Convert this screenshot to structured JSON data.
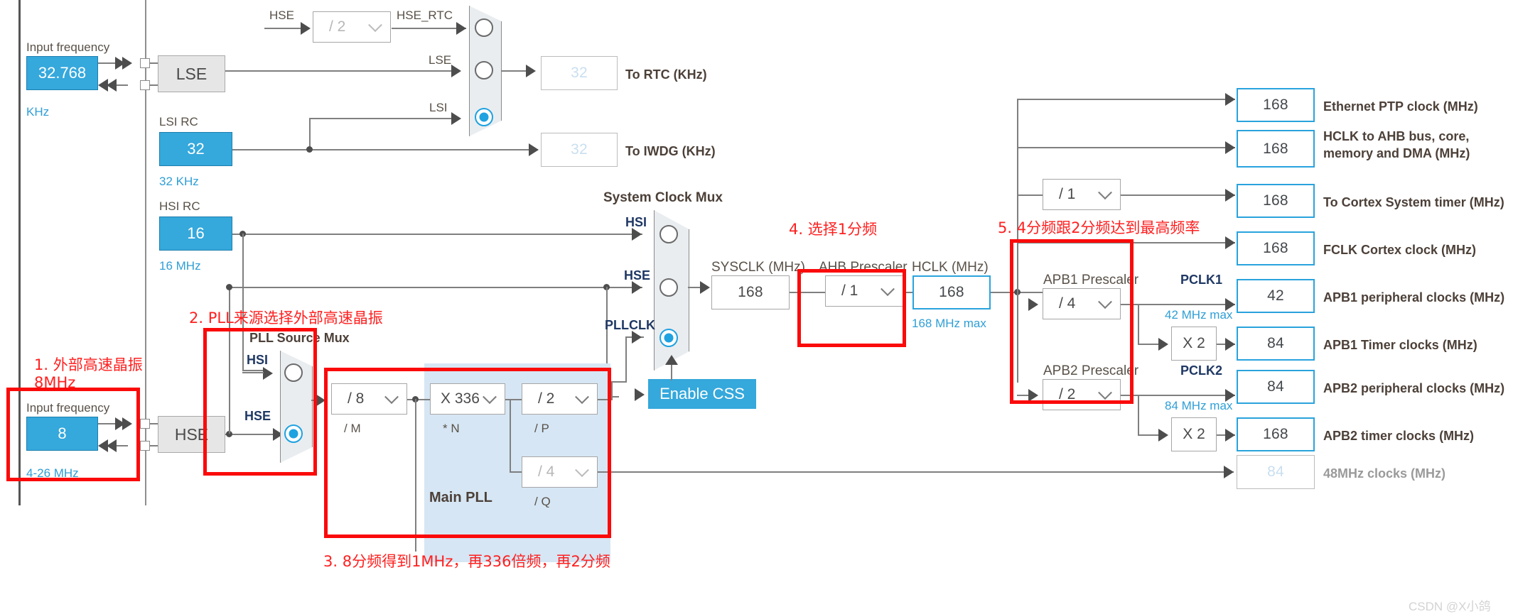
{
  "meta": {
    "watermark": "CSDN @X小鸽"
  },
  "lse": {
    "input_label": "Input frequency",
    "value": "32.768",
    "unit": "KHz",
    "block": "LSE",
    "mux_label": "LSE"
  },
  "hse_rtc": {
    "src_label": "HSE",
    "divider": "/ 2",
    "out_label": "HSE_RTC"
  },
  "lsi": {
    "title": "LSI RC",
    "value": "32",
    "range": "32 KHz",
    "mux_label": "LSI"
  },
  "rtc_outputs": [
    {
      "value": "32",
      "label": "To RTC (KHz)"
    },
    {
      "value": "32",
      "label": "To IWDG (KHz)"
    }
  ],
  "hsi": {
    "title": "HSI RC",
    "value": "16",
    "range": "16 MHz"
  },
  "hse": {
    "input_label": "Input frequency",
    "value": "8",
    "range": "4-26 MHz",
    "block": "HSE"
  },
  "pll_source_mux": {
    "title": "PLL Source Mux",
    "inputs": [
      "HSI",
      "HSE"
    ],
    "selected": "HSE"
  },
  "main_pll": {
    "title": "Main PLL",
    "m": {
      "value": "/ 8",
      "sub": "/ M"
    },
    "n": {
      "value": "X 336",
      "sub": "* N"
    },
    "p": {
      "value": "/ 2",
      "sub": "/ P"
    },
    "q": {
      "value": "/ 4",
      "sub": "/ Q"
    }
  },
  "system_clock_mux": {
    "title": "System Clock Mux",
    "inputs": [
      "HSI",
      "HSE",
      "PLLCLK"
    ],
    "selected": "PLLCLK",
    "css_button": "Enable CSS"
  },
  "sysclk": {
    "label": "SYSCLK (MHz)",
    "value": "168"
  },
  "ahb_prescaler": {
    "label": "AHB Prescaler",
    "value": "/ 1"
  },
  "hclk": {
    "label": "HCLK (MHz)",
    "value": "168",
    "max": "168 MHz max"
  },
  "cortex_sys_timer_prescaler": {
    "value": "/ 1"
  },
  "apb1": {
    "label": "APB1 Prescaler",
    "value": "/ 4",
    "pclk_label": "PCLK1",
    "pclk_max": "42 MHz max",
    "multiplier": "X 2"
  },
  "apb2": {
    "label": "APB2 Prescaler",
    "value": "/ 2",
    "pclk_label": "PCLK2",
    "pclk_max": "84 MHz max",
    "multiplier": "X 2"
  },
  "outputs": [
    {
      "value": "168",
      "label": "Ethernet PTP clock (MHz)"
    },
    {
      "value": "168",
      "label": "HCLK to AHB bus, core,\nmemory and DMA (MHz)"
    },
    {
      "value": "168",
      "label": "To Cortex System timer (MHz)"
    },
    {
      "value": "168",
      "label": "FCLK Cortex clock (MHz)"
    },
    {
      "value": "42",
      "label": "APB1 peripheral clocks (MHz)"
    },
    {
      "value": "84",
      "label": "APB1 Timer clocks (MHz)"
    },
    {
      "value": "84",
      "label": "APB2 peripheral clocks (MHz)"
    },
    {
      "value": "168",
      "label": "APB2 timer clocks (MHz)"
    },
    {
      "value": "84",
      "label": "48MHz clocks (MHz)"
    }
  ],
  "annotations": [
    {
      "id": "a1",
      "text": "1. 外部高速晶振"
    },
    {
      "id": "a1b",
      "text": "8MHz"
    },
    {
      "id": "a2",
      "text": "2. PLL来源选择外部高速晶振"
    },
    {
      "id": "a3",
      "text": "3. 8分频得到1MHz，再336倍频，再2分频"
    },
    {
      "id": "a4",
      "text": "4. 选择1分频"
    },
    {
      "id": "a5",
      "text": "5. 4分频跟2分频达到最高频率"
    }
  ],
  "colors": {
    "accent_blue": "#35a8dc",
    "annotation_red": "#ff2020",
    "wire_grey": "#7f7f7f",
    "mux_fill": "#e9edf0",
    "pll_fill": "#d6e6f4"
  }
}
